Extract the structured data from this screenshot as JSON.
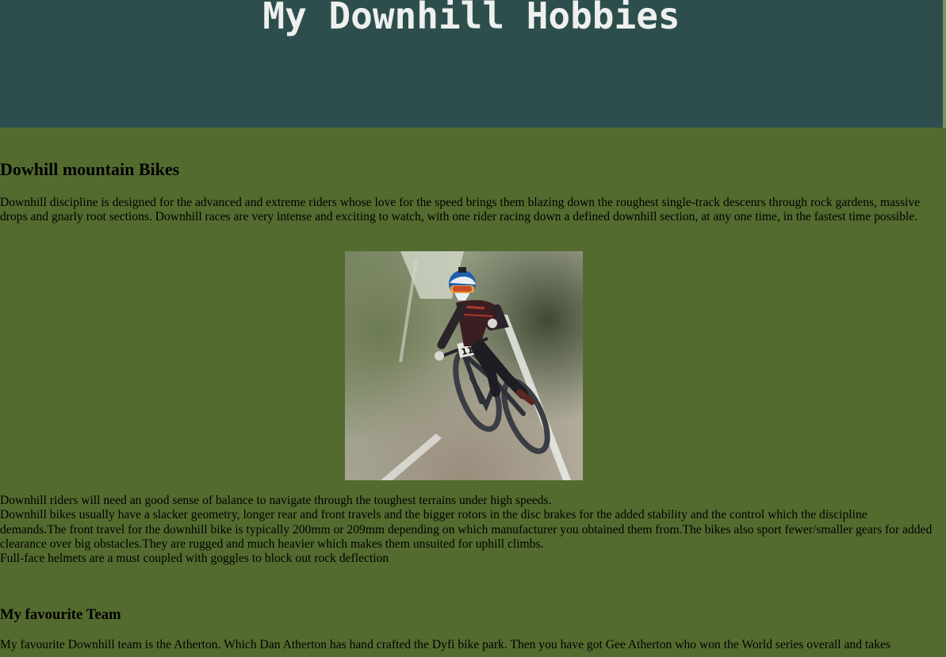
{
  "header": {
    "title": "My Downhill Hobbies"
  },
  "sections": {
    "bikes": {
      "heading": "Dowhill mountain Bikes",
      "intro": "Downhill discipline is designed for the advanced and extreme riders whose love for the speed brings them blazing down the roughest single-track descenrs through rock gardens, massive drops and gnarly root sections. Downhill races are very intense and exciting to watch, with one rider racing down a defined downhill section, at any one time, in the fastest time possible.",
      "image": {
        "number_plate": "116"
      },
      "line_balance": "Downhill riders will need an good sense of balance to navigate through the toughest terrains under high speeds.",
      "line_geometry": "Downhill bikes usually have a slacker geometry, longer rear and front travels and the bigger rotors in the disc brakes for the added stability and the control which the discipline demands.The front travel for the downhill bike is typically 200mm or 209mm depending on which manufacturer you obtained them from.The bikes also sport fewer/smaller gears for added clearance over big obstacles.They are rugged and much heavier which makes them unsuited for uphill climbs.",
      "line_helmets": "Full-face helmets are a must coupled with goggles to block out rock deflection"
    },
    "team": {
      "heading": "My favourite Team",
      "text": "My favourite Downhill team is the Atherton. Which Dan Atherton has hand crafted the Dyfi bike park. Then you have got Gee Atherton who won the World series overall and takes"
    }
  },
  "colors": {
    "page_background": "#546b2f",
    "header_background": "#2e4e4e",
    "title_text": "#eef0ee",
    "body_text": "#000000"
  }
}
